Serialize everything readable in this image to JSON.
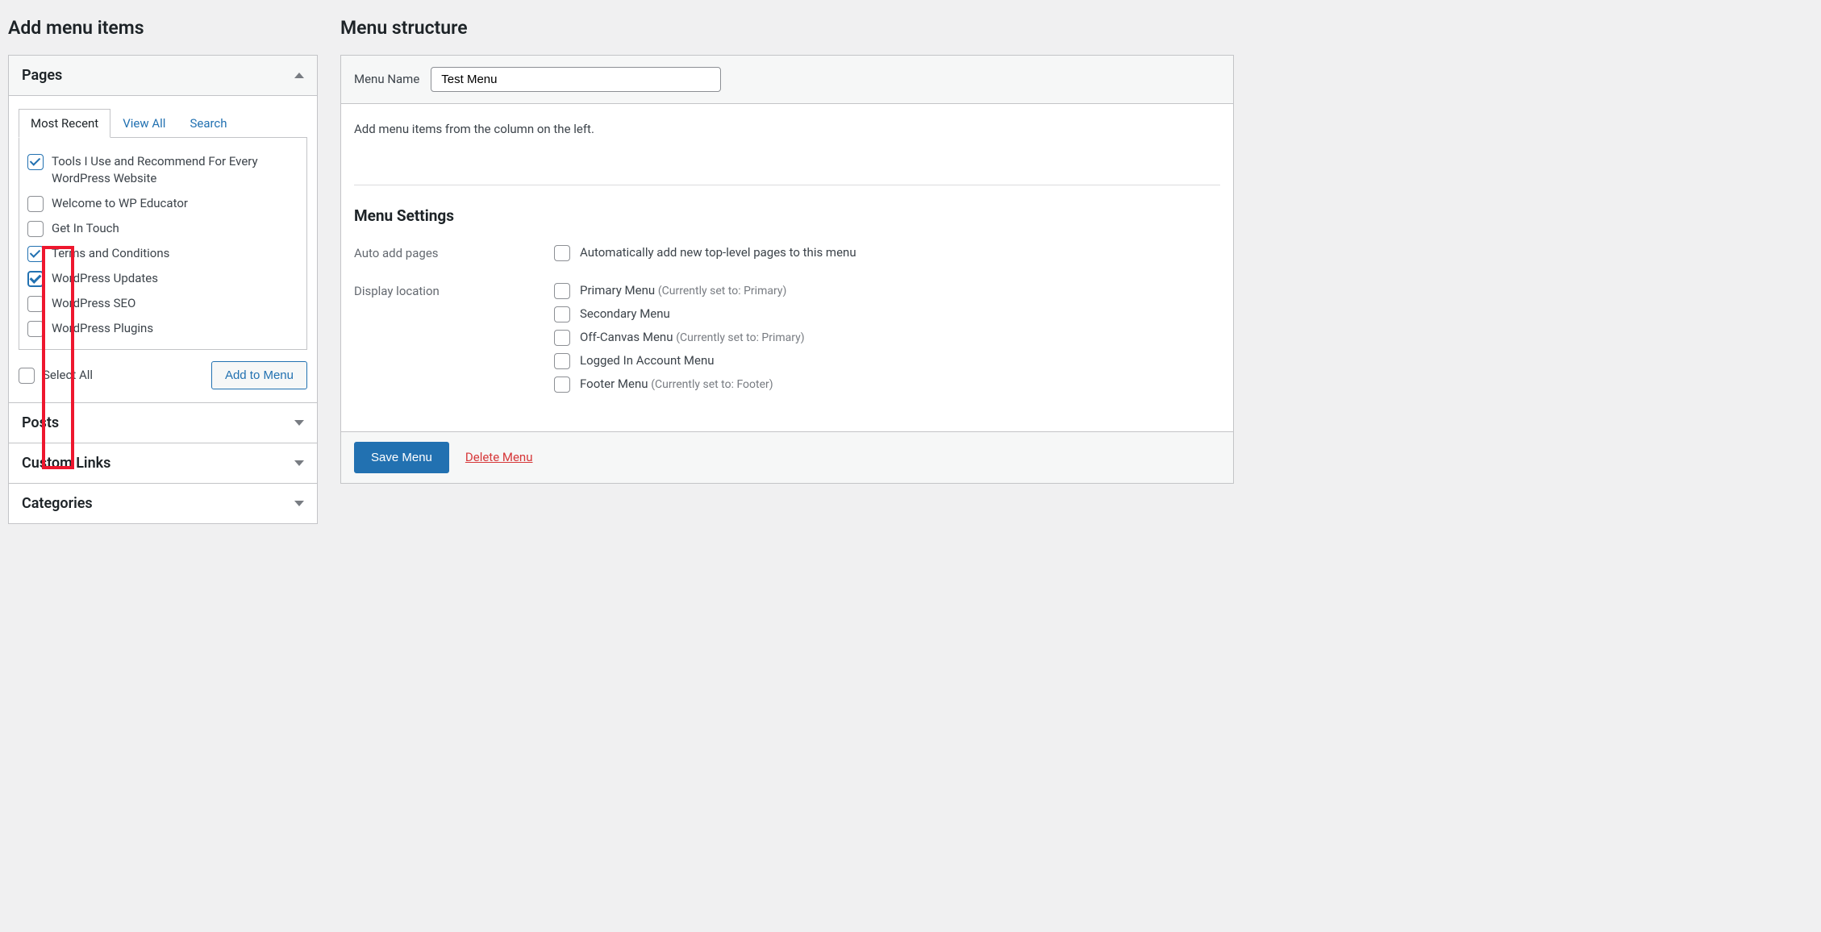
{
  "left": {
    "heading": "Add menu items",
    "pagesPanel": {
      "title": "Pages",
      "tabs": {
        "recent": "Most Recent",
        "all": "View All",
        "search": "Search"
      },
      "items": [
        {
          "label": "Tools I Use and Recommend For Every WordPress Website",
          "checked": true
        },
        {
          "label": "Welcome to WP Educator",
          "checked": false
        },
        {
          "label": "Get In Touch",
          "checked": false
        },
        {
          "label": "Terms and Conditions",
          "checked": true
        },
        {
          "label": "WordPress Updates",
          "checked": true
        },
        {
          "label": "WordPress SEO",
          "checked": false
        },
        {
          "label": "WordPress Plugins",
          "checked": false
        }
      ],
      "selectAll": "Select All",
      "addBtn": "Add to Menu"
    },
    "postsPanel": {
      "title": "Posts"
    },
    "linksPanel": {
      "title": "Custom Links"
    },
    "catsPanel": {
      "title": "Categories"
    }
  },
  "right": {
    "heading": "Menu structure",
    "menuNameLabel": "Menu Name",
    "menuNameValue": "Test Menu",
    "instruction": "Add menu items from the column on the left.",
    "settings": {
      "title": "Menu Settings",
      "autoAddLabel": "Auto add pages",
      "autoAddOption": "Automatically add new top-level pages to this menu",
      "displayLabel": "Display location",
      "locations": [
        {
          "label": "Primary Menu",
          "note": "(Currently set to: Primary)"
        },
        {
          "label": "Secondary Menu",
          "note": ""
        },
        {
          "label": "Off-Canvas Menu",
          "note": "(Currently set to: Primary)"
        },
        {
          "label": "Logged In Account Menu",
          "note": ""
        },
        {
          "label": "Footer Menu",
          "note": "(Currently set to: Footer)"
        }
      ]
    },
    "saveBtn": "Save Menu",
    "deleteLink": "Delete Menu"
  }
}
